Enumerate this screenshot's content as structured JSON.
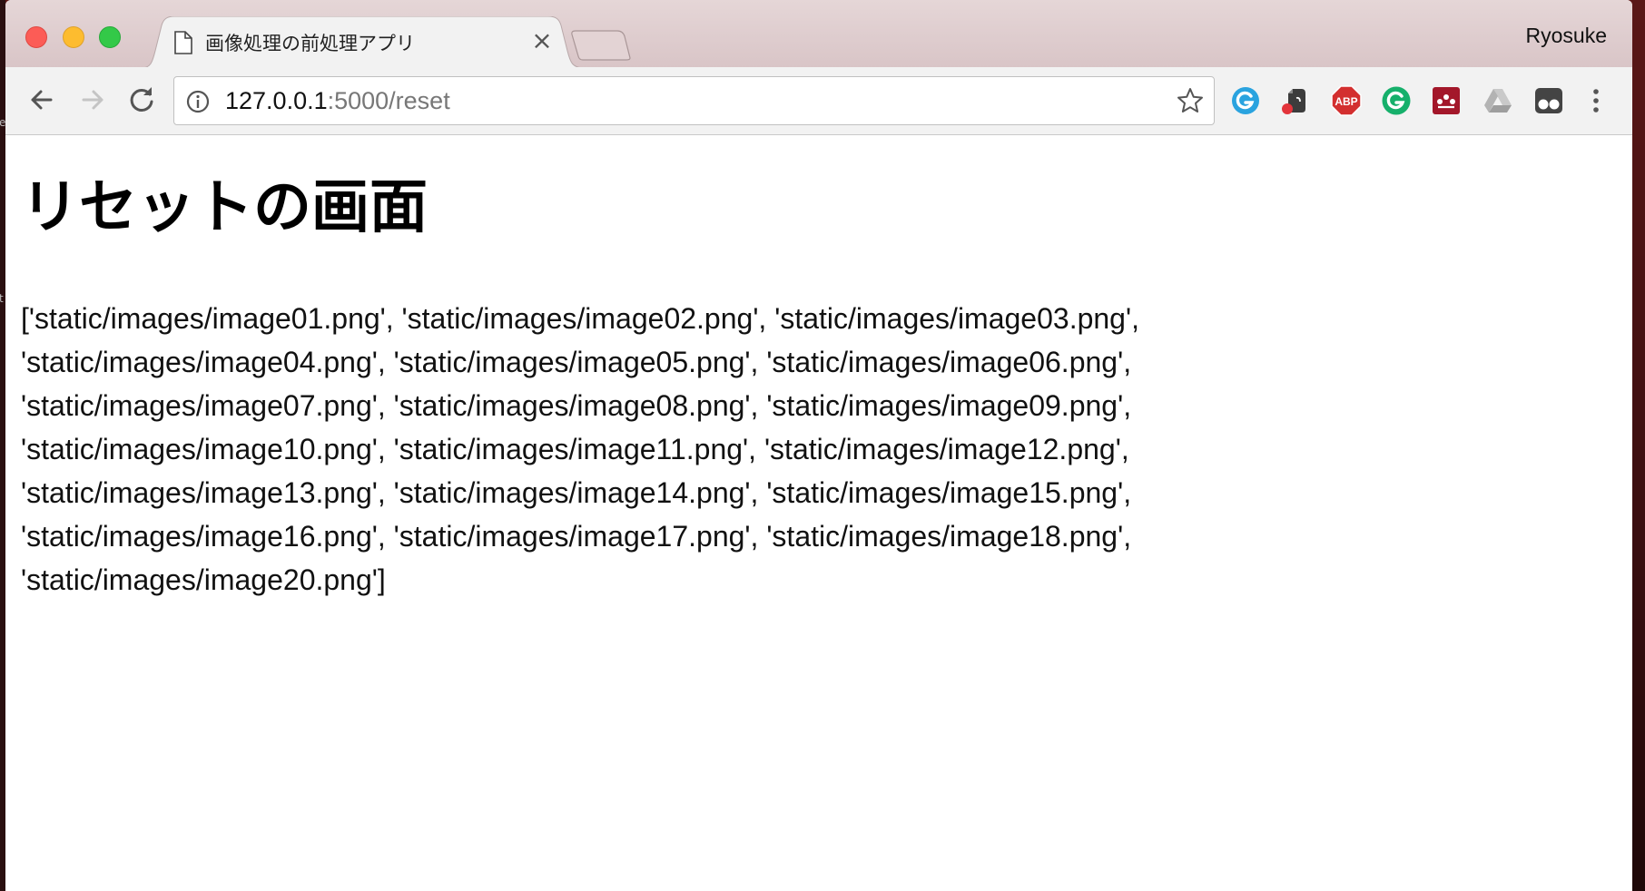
{
  "browser": {
    "tab": {
      "title": "画像処理の前処理アプリ",
      "close_glyph": "×"
    },
    "profile_name": "Ryosuke",
    "address_bar": {
      "host": "127.0.0.1",
      "path": ":5000/reset"
    },
    "extensions": [
      "grammarly-icon",
      "evernote-icon",
      "adblock-plus-icon",
      "grammarly-green-icon",
      "mendeley-icon",
      "google-drive-icon",
      "tampermonkey-icon"
    ]
  },
  "page": {
    "title": "リセットの画面",
    "image_list_text": "['static/images/image01.png', 'static/images/image02.png', 'static/images/image03.png', 'static/images/image04.png', 'static/images/image05.png', 'static/images/image06.png', 'static/images/image07.png', 'static/images/image08.png', 'static/images/image09.png', 'static/images/image10.png', 'static/images/image11.png', 'static/images/image12.png', 'static/images/image13.png', 'static/images/image14.png', 'static/images/image15.png', 'static/images/image16.png', 'static/images/image17.png', 'static/images/image18.png', 'static/images/image20.png']"
  },
  "colors": {
    "desktop": "#5a1414",
    "tab_strip": "#ddcbcc",
    "toolbar": "#f2f2f2",
    "abp_red": "#d32f2f",
    "grammarly_green": "#16b06b",
    "mendeley_red": "#a3172a"
  }
}
